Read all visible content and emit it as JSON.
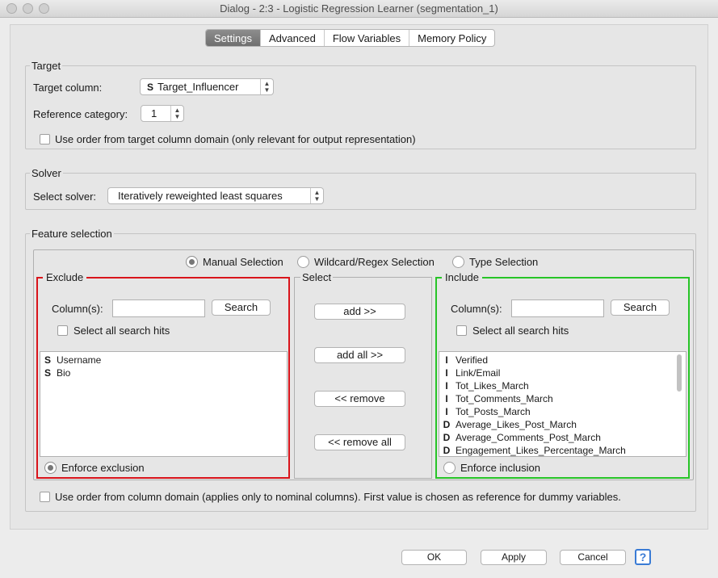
{
  "window": {
    "title": "Dialog - 2:3 - Logistic Regression Learner (segmentation_1)"
  },
  "tabs": [
    {
      "label": "Settings"
    },
    {
      "label": "Advanced"
    },
    {
      "label": "Flow Variables"
    },
    {
      "label": "Memory Policy"
    }
  ],
  "target": {
    "group_title": "Target",
    "target_column_label": "Target column:",
    "target_column_type": "S",
    "target_column_value": "Target_Influencer",
    "reference_label": "Reference category:",
    "reference_value": "1",
    "domain_order_label": "Use order from target column domain (only relevant for output representation)"
  },
  "solver": {
    "group_title": "Solver",
    "select_label": "Select solver:",
    "select_value": "Iteratively reweighted least squares"
  },
  "features": {
    "group_title": "Feature selection",
    "modes": [
      "Manual Selection",
      "Wildcard/Regex Selection",
      "Type Selection"
    ],
    "exclude": {
      "title": "Exclude",
      "columns_label": "Column(s):",
      "search_button": "Search",
      "select_all_label": "Select all search hits",
      "items": [
        {
          "type": "S",
          "name": "Username"
        },
        {
          "type": "S",
          "name": "Bio"
        }
      ],
      "enforce_label": "Enforce exclusion"
    },
    "select": {
      "title": "Select",
      "add": "add >>",
      "add_all": "add all >>",
      "remove": "<< remove",
      "remove_all": "<< remove all"
    },
    "include": {
      "title": "Include",
      "columns_label": "Column(s):",
      "search_button": "Search",
      "select_all_label": "Select all search hits",
      "items": [
        {
          "type": "I",
          "name": "Verified"
        },
        {
          "type": "I",
          "name": "Link/Email"
        },
        {
          "type": "I",
          "name": "Tot_Likes_March"
        },
        {
          "type": "I",
          "name": "Tot_Comments_March"
        },
        {
          "type": "I",
          "name": "Tot_Posts_March"
        },
        {
          "type": "D",
          "name": "Average_Likes_Post_March"
        },
        {
          "type": "D",
          "name": "Average_Comments_Post_March"
        },
        {
          "type": "D",
          "name": "Engagement_Likes_Percentage_March"
        }
      ],
      "enforce_label": "Enforce inclusion"
    },
    "column_domain_label": "Use order from column domain (applies only to nominal columns). First value is chosen as reference for dummy variables."
  },
  "buttons": {
    "ok": "OK",
    "apply": "Apply",
    "cancel": "Cancel",
    "help": "?"
  },
  "colors": {
    "exclude_border": "#d9141b",
    "include_border": "#27c427",
    "help_blue": "#3a7bd5"
  }
}
